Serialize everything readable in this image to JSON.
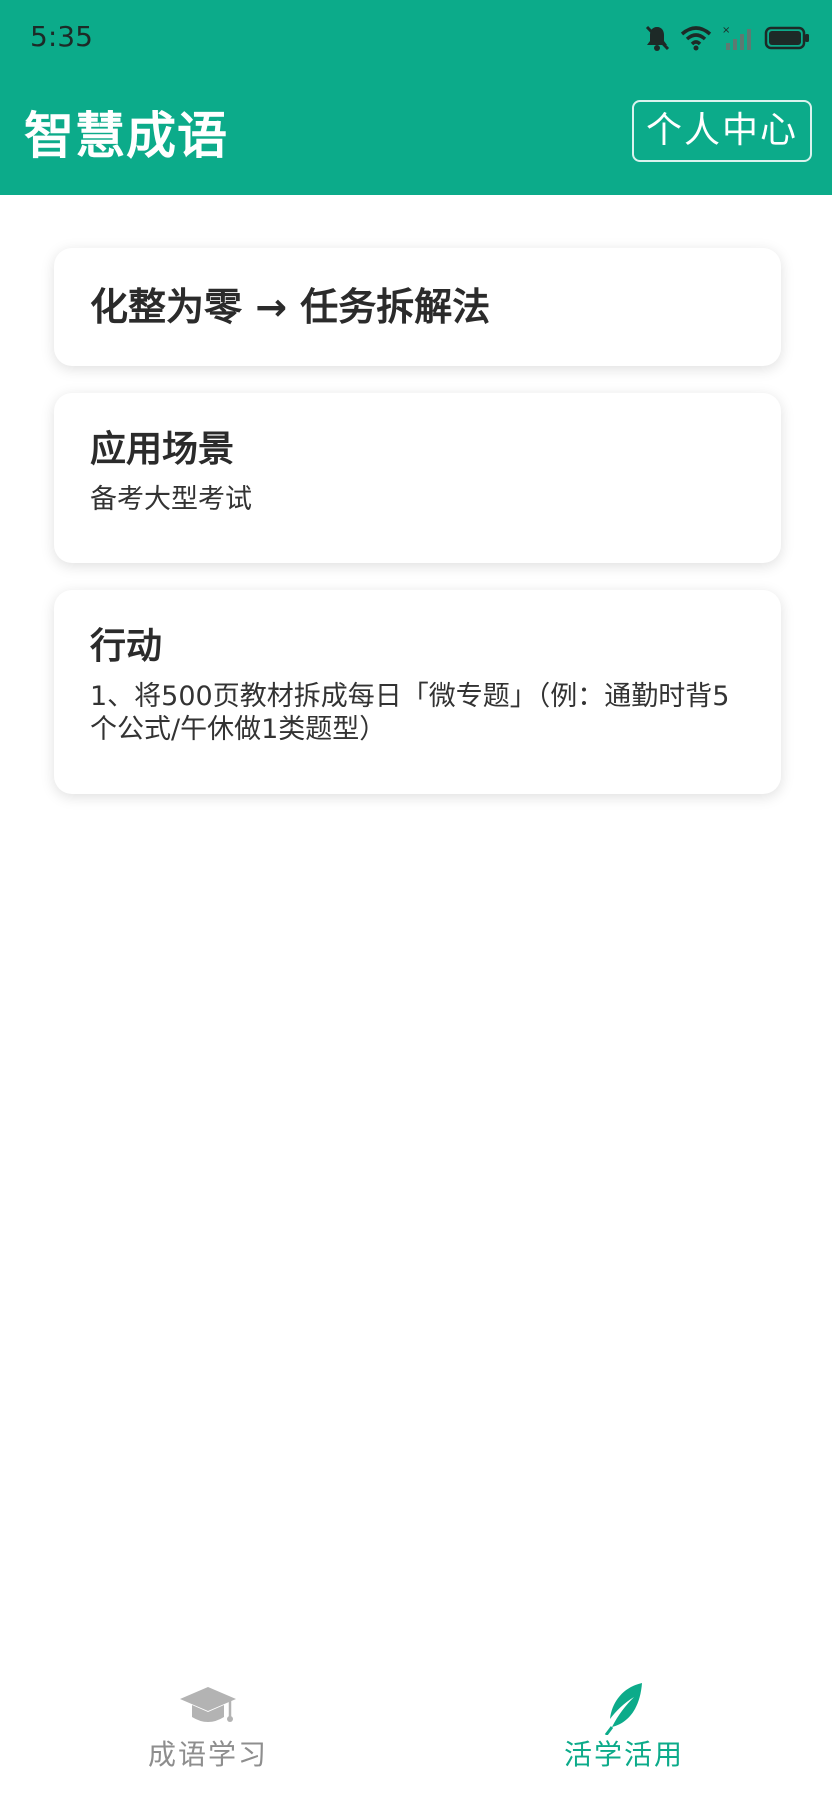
{
  "status_bar": {
    "time": "5:35"
  },
  "header": {
    "title": "智慧成语",
    "profile_button": "个人中心"
  },
  "cards": {
    "main": {
      "heading": "化整为零 → 任务拆解法"
    },
    "scene": {
      "heading": "应用场景",
      "text": "备考大型考试"
    },
    "action": {
      "heading": "行动",
      "text": "1、将500页教材拆成每日「微专题」（例：通勤时背5个公式/午休做1类题型）"
    }
  },
  "bottom_nav": {
    "items": [
      {
        "label": "成语学习",
        "icon": "graduation-cap-icon",
        "active": false
      },
      {
        "label": "活学活用",
        "icon": "feather-icon",
        "active": true
      }
    ]
  },
  "colors": {
    "primary": "#0cab8a",
    "inactive": "#8e8e8e"
  }
}
